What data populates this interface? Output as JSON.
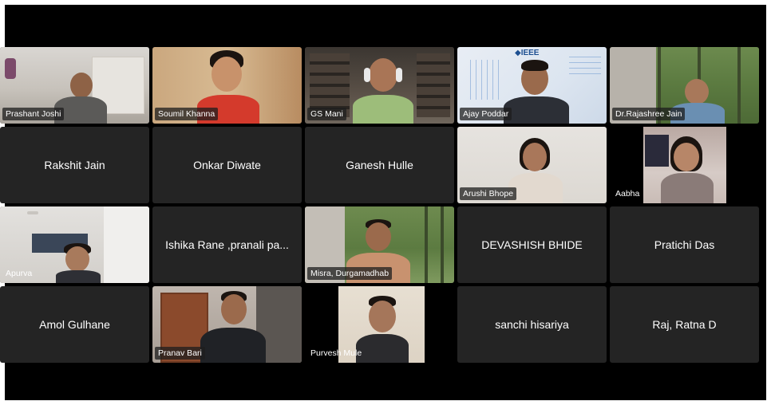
{
  "participants": [
    {
      "name": "Prashant Joshi",
      "video": true
    },
    {
      "name": "Soumil Khanna",
      "video": true
    },
    {
      "name": "GS Mani",
      "video": true
    },
    {
      "name": "Ajay Poddar",
      "video": true,
      "overlay_logo": "◆IEEE"
    },
    {
      "name": "Dr.Rajashree Jain",
      "video": true
    },
    {
      "name": "Rakshit Jain",
      "video": false
    },
    {
      "name": "Onkar Diwate",
      "video": false
    },
    {
      "name": "Ganesh Hulle",
      "video": false
    },
    {
      "name": "Arushi Bhope",
      "video": true
    },
    {
      "name": "Aabha",
      "video": true
    },
    {
      "name": "Apurva",
      "video": true
    },
    {
      "name": "Ishika Rane ,pranali pa...",
      "video": false
    },
    {
      "name": "Misra, Durgamadhab",
      "video": true
    },
    {
      "name": "DEVASHISH BHIDE",
      "video": false
    },
    {
      "name": "Pratichi Das",
      "video": false
    },
    {
      "name": "Amol Gulhane",
      "video": false
    },
    {
      "name": "Pranav Bari",
      "video": true
    },
    {
      "name": "Purvesh Mule",
      "video": true
    },
    {
      "name": "sanchi hisariya",
      "video": false
    },
    {
      "name": "Raj, Ratna D",
      "video": false
    }
  ],
  "colors": {
    "screen_bg": "#000000",
    "tile_bg": "#242424",
    "label_bg": "#1e1e1e",
    "text": "#ffffff"
  }
}
